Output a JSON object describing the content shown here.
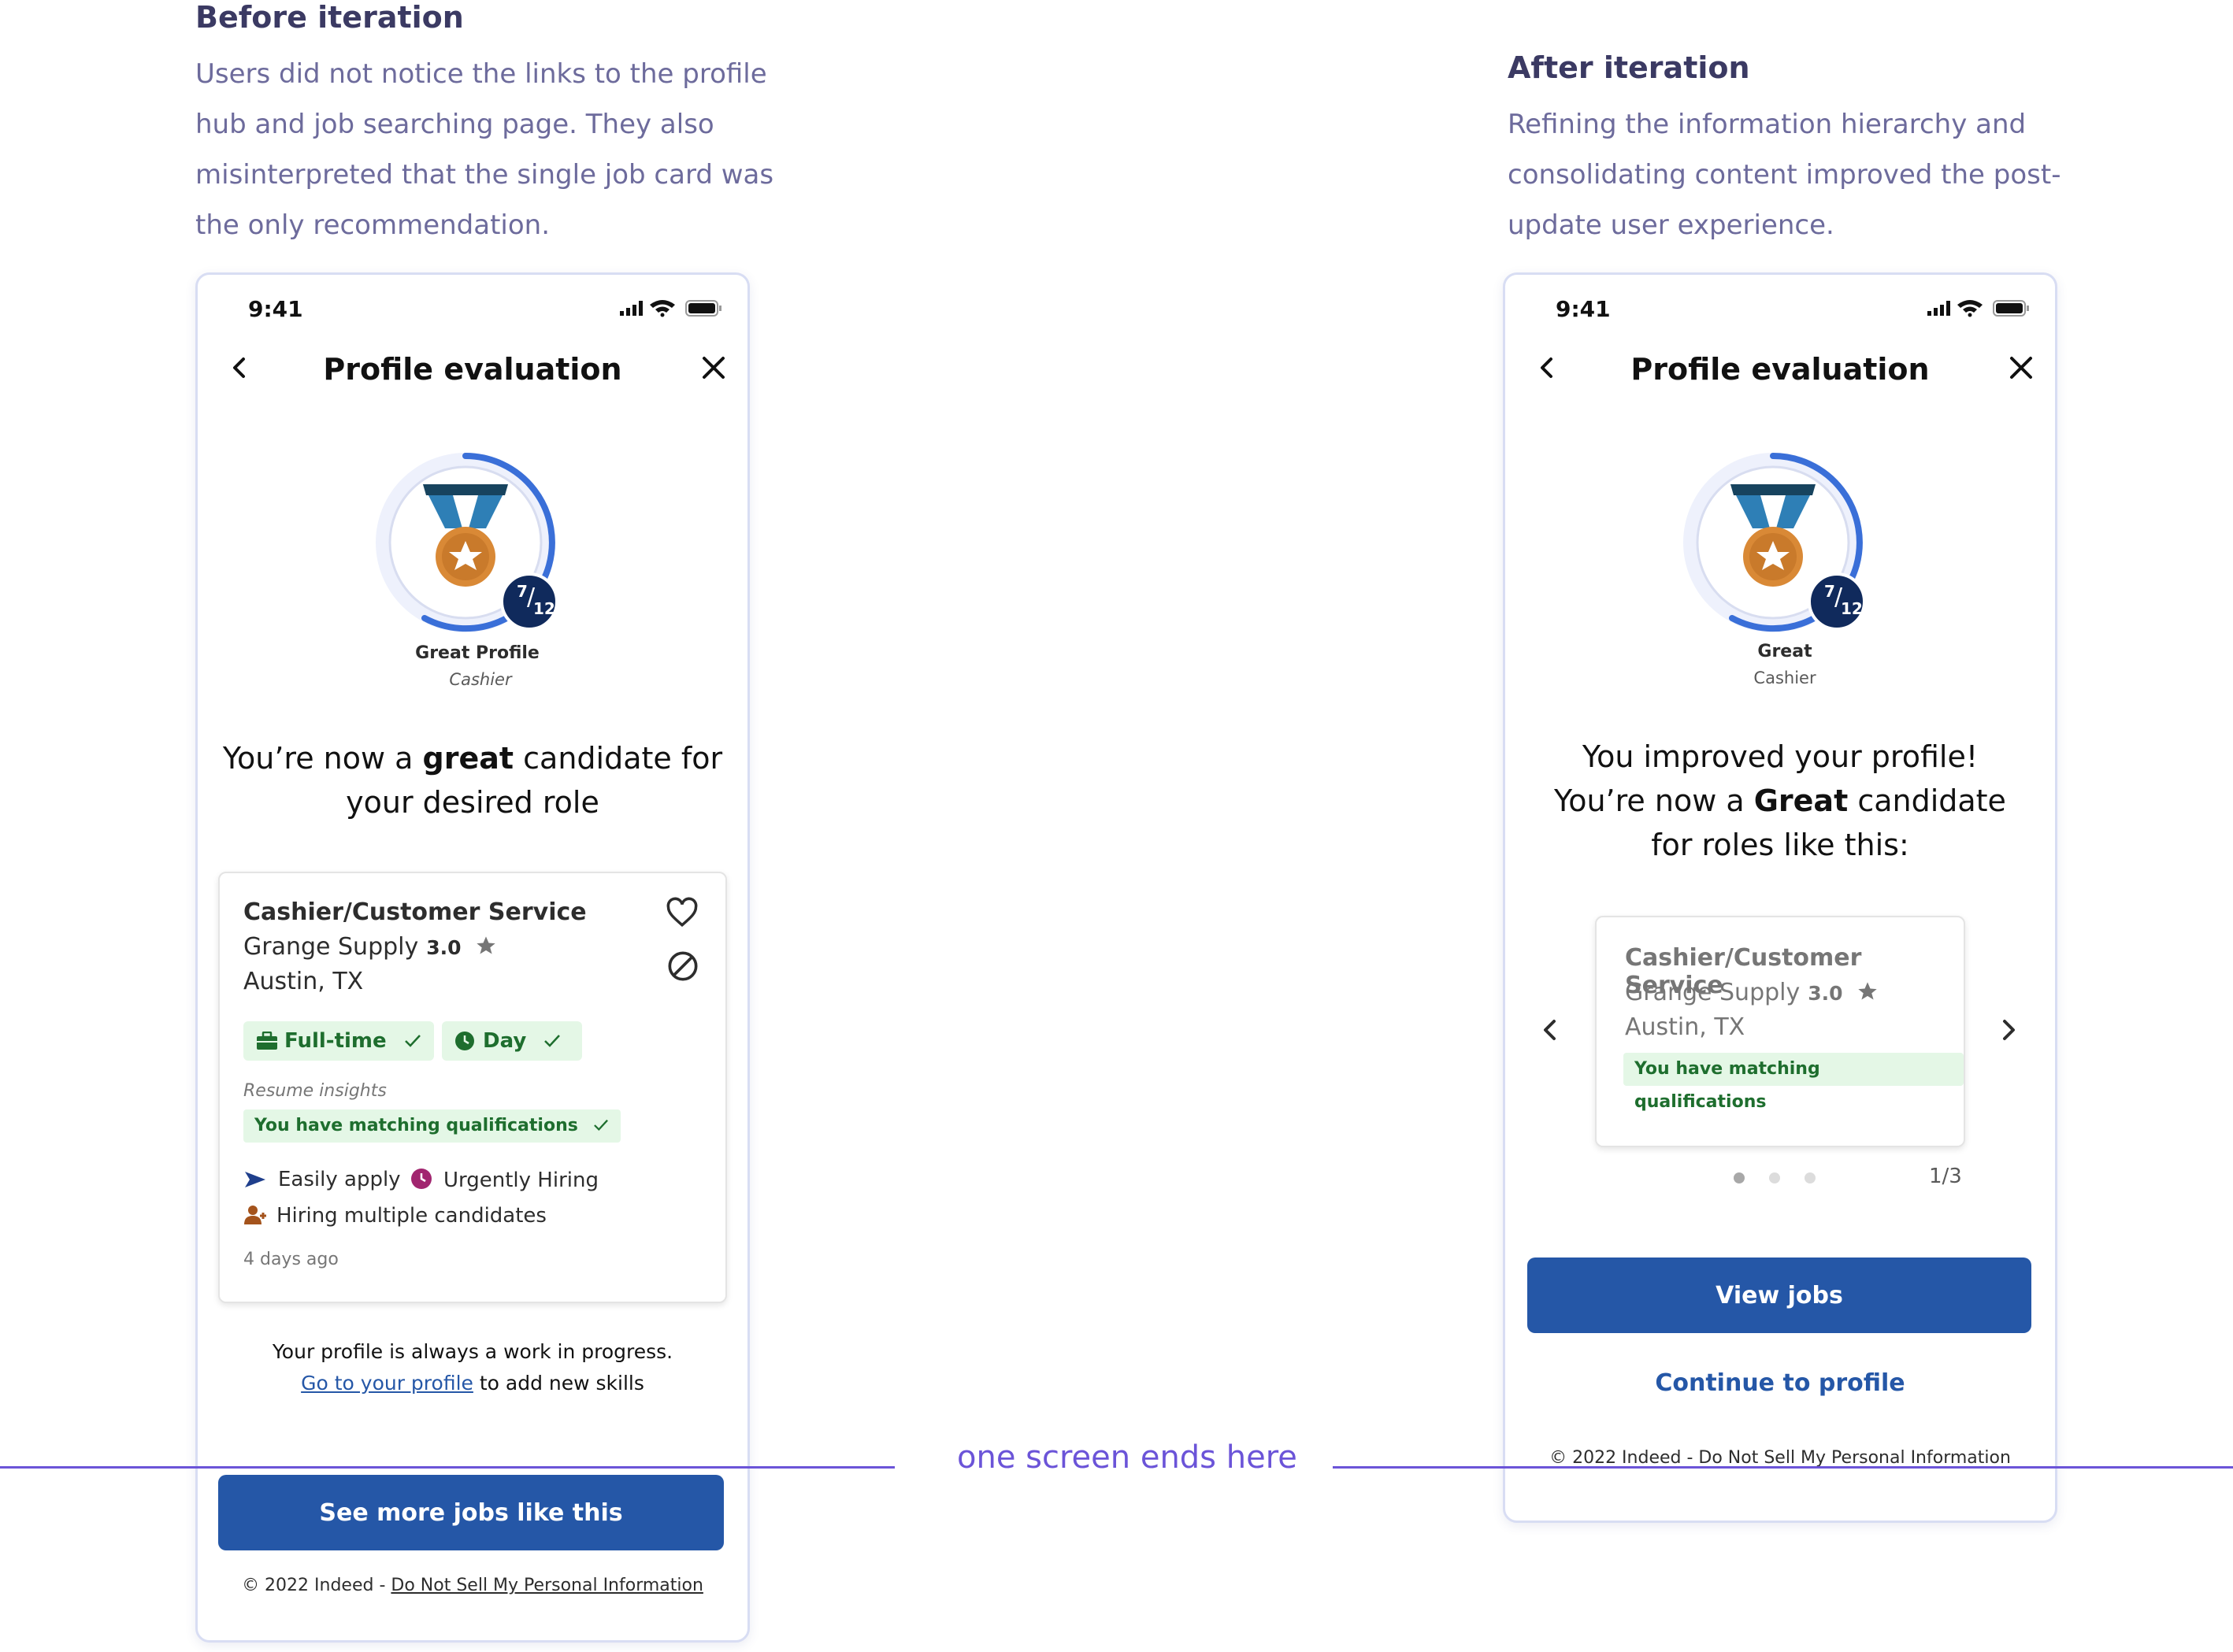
{
  "before": {
    "title": "Before iteration",
    "description_lines": [
      "Users did not notice the links to the profile",
      "hub and job searching page. They also",
      "misinterpreted that the single job card was",
      "the only recommendation."
    ],
    "phone": {
      "time": "9:41",
      "nav_title": "Profile evaluation",
      "score": {
        "num": "7",
        "den": "12"
      },
      "level_title": "Great Profile",
      "level_role": "Cashier",
      "headline_pre": "You’re now a ",
      "headline_bold": "great",
      "headline_post": " candidate for",
      "headline_line2": "your desired role",
      "job": {
        "title": "Cashier/Customer Service",
        "company": "Grange Supply",
        "rating": "3.0",
        "location": "Austin, TX",
        "chip_fulltime": "Full-time",
        "chip_day": "Day",
        "insights_label": "Resume insights",
        "insight_text": "You have matching qualifications",
        "easily_apply": "Easily apply",
        "urgently_hiring": "Urgently Hiring",
        "hiring_multiple": "Hiring multiple candidates",
        "posted": "4 days ago"
      },
      "note_line1": "Your profile is always a work in progress.",
      "note_link": "Go to your profile",
      "note_after": " to add new skills",
      "cta": "See more jobs like this",
      "footer_prefix": "© 2022 Indeed - ",
      "footer_link": "Do Not Sell My Personal Information"
    }
  },
  "after": {
    "title": "After iteration",
    "description_lines": [
      "Refining the information hierarchy and",
      "consolidating content improved the post-",
      "update user experience."
    ],
    "phone": {
      "time": "9:41",
      "nav_title": "Profile evaluation",
      "score": {
        "num": "7",
        "den": "12"
      },
      "level_title": "Great",
      "level_role": "Cashier",
      "headline_line1": "You improved your profile!",
      "headline_pre": "You’re now a ",
      "headline_bold": "Great",
      "headline_post": " candidate",
      "headline_line3": "for roles like this:",
      "job": {
        "title": "Cashier/Customer Service",
        "company": "Grange Supply",
        "rating": "3.0",
        "location": "Austin, TX",
        "insight_text": "You have matching qualifications"
      },
      "carousel_count": "1/3",
      "cta": "View jobs",
      "secondary": "Continue to profile",
      "footer": "© 2022 Indeed - Do Not Sell My Personal Information"
    }
  },
  "divider_text": "one screen ends here",
  "colors": {
    "accent": "#2557a7",
    "divider": "#6b54d8",
    "heading": "#3b3a63",
    "desc": "#6d6b9c",
    "chip_bg": "#e4f7e6",
    "chip_text": "#1e6e2e"
  }
}
